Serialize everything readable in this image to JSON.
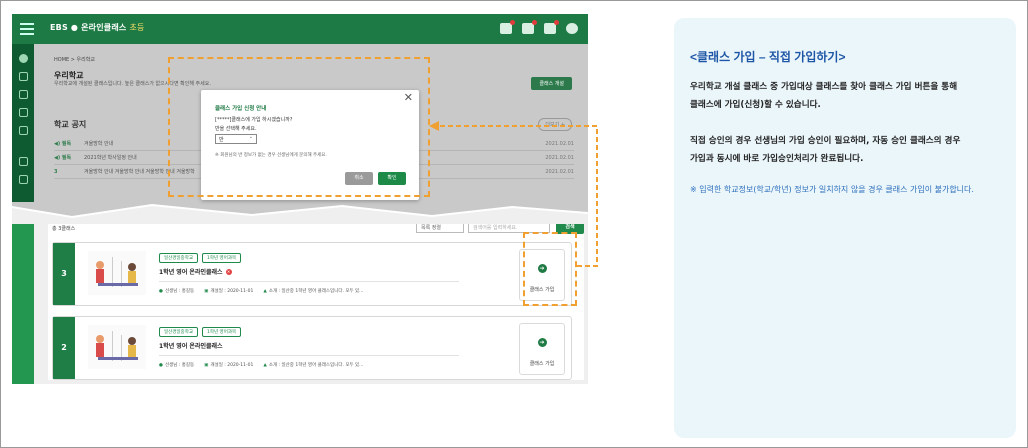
{
  "app": {
    "logo": "EBS",
    "service": "온라인클래스",
    "level": "초등"
  },
  "breadcrumb": "HOME > 우리학교",
  "page": {
    "title": "우리학교",
    "desc": "우리학교에 개설된 클래스입니다. 높은 클래스가 없으시다면 확인해 주세요.",
    "create_btn": "클래스 개설"
  },
  "notice": {
    "title": "학교 공지",
    "more": "더보기 +",
    "rows": [
      {
        "tag": "◀) 필독",
        "title": "겨울방학 안내",
        "date": "2021.02.01"
      },
      {
        "tag": "◀) 필독",
        "title": "2021학년 학사일정 안내",
        "date": "2021.02.01"
      },
      {
        "tag": "3",
        "title": "겨울방학 안내 겨울방학 안내 겨울방학 안내 겨울방학",
        "date": "2021.02.01"
      }
    ]
  },
  "list": {
    "count": "총 3클래스",
    "sort": "목록 정렬",
    "search_placeholder": "검색어를 입력하세요.",
    "search_btn": "검색",
    "cards": [
      {
        "num": "3",
        "tags": [
          "일산경일중학교",
          "1학년 영어과목"
        ],
        "title": "1학년 영어 온라인클래스",
        "teacher": "선생님 : 홍길동",
        "date": "개설일 : 2020-11-01",
        "intro": "소개 : 일산중 1학년 영어 클래스입니다. 모두 있...",
        "join": "클래스 가입"
      },
      {
        "num": "2",
        "tags": [
          "일산경일중학교",
          "1학년 영어과목"
        ],
        "title": "1학년 영어 온라인클래스",
        "teacher": "선생님 : 홍길동",
        "date": "개설일 : 2020-11-01",
        "intro": "소개 : 일산중 1학년 영어 클래스입니다. 모두 있...",
        "join": "클래스 가입"
      }
    ]
  },
  "modal": {
    "title": "클래스 가입 신청 안내",
    "line1": "[*****]클래스에 가입 하시겠습니까?",
    "line2": "반을 선택해 주세요.",
    "select_value": "반",
    "note": "※ 회원님의 반 정보가 없는 경우 선생님에게 문의해 주세요.",
    "cancel": "취소",
    "confirm": "확인"
  },
  "panel": {
    "title": "<클래스 가입 – 직접 가입하기>",
    "p1_line1": "우리학교 개설 클래스 중 가입대상 클래스를 찾아 클래스 가입 버튼을 통해",
    "p1_line2": "클래스에 가입(신청)할 수 있습니다.",
    "p2_line1": "직접 승인의 경우 선생님의 가입 승인이 필요하며, 자동 승인 클래스의 경우",
    "p2_line2": "가입과 동시에 바로 가입승인처리가 완료됩니다.",
    "note": "※ 입력한 학교정보(학교/학년) 정보가 일치하지 않을 경우 클래스 가입이 불가합니다."
  },
  "colors": {
    "brand_green": "#1d7a44",
    "highlight_orange": "#f0a030",
    "panel_bg": "#ebf6fb",
    "panel_title": "#1e56a6"
  }
}
